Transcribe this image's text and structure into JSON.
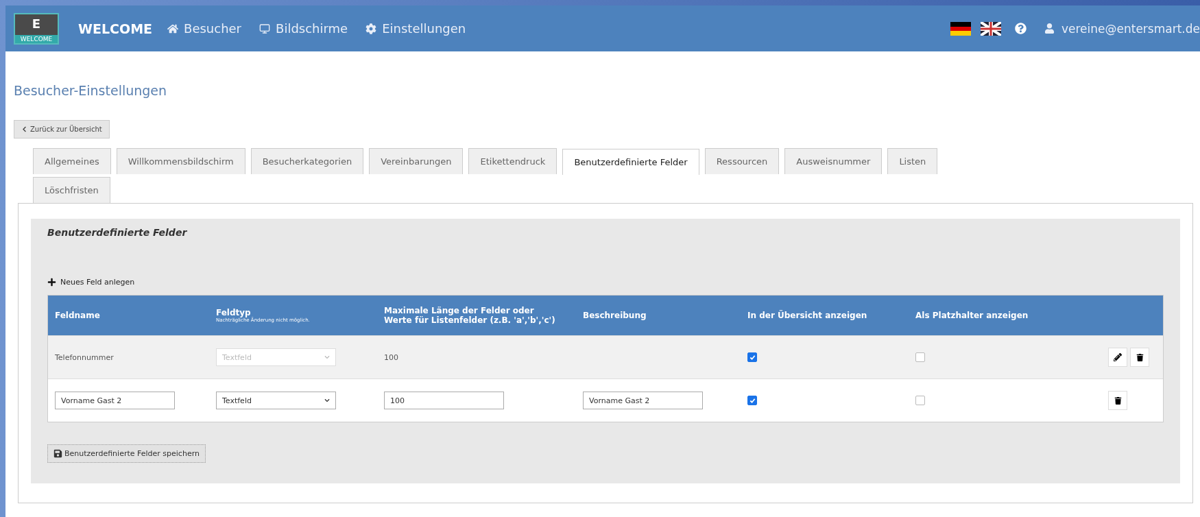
{
  "navbar": {
    "logo_letter": "E",
    "logo_caption": "WELCOME",
    "brand": "WELCOME",
    "items": [
      {
        "label": "Besucher",
        "kind": "home"
      },
      {
        "label": "Bildschirme",
        "kind": "monitor"
      },
      {
        "label": "Einstellungen",
        "kind": "settings"
      }
    ],
    "languages": [
      {
        "kind": "de"
      },
      {
        "kind": "uk"
      }
    ],
    "user": "vereine@entersmart.de"
  },
  "page_title": "Besucher-Einstellungen",
  "back_button": "Zurück zur Übersicht",
  "tabs": [
    {
      "label": "Allgemeines",
      "selected": false
    },
    {
      "label": "Willkommensbildschirm",
      "selected": false
    },
    {
      "label": "Besucherkategorien",
      "selected": false
    },
    {
      "label": "Vereinbarungen",
      "selected": false
    },
    {
      "label": "Etikettendruck",
      "selected": false
    },
    {
      "label": "Benutzerdefinierte Felder",
      "selected": true
    },
    {
      "label": "Ressourcen",
      "selected": false
    },
    {
      "label": "Ausweisnummer",
      "selected": false
    },
    {
      "label": "Listen",
      "selected": false
    },
    {
      "label": "Löschfristen",
      "selected": false
    }
  ],
  "section": {
    "legend": "Benutzerdefinierte Felder",
    "new_field": "Neues Feld anlegen",
    "columns": [
      {
        "label": "Feldname"
      },
      {
        "label": "Feldtyp",
        "note": "Nachträgliche Änderung nicht möglich."
      },
      {
        "label": "Maximale Länge der Felder oder Werte für Listenfelder (z.B. 'a','b','c')"
      },
      {
        "label": "Beschreibung"
      },
      {
        "label": "In der Übersicht anzeigen"
      },
      {
        "label": "Als Platzhalter anzeigen"
      }
    ],
    "rows": [
      {
        "kind": "saved",
        "name": "Telefonnummer",
        "type": "Textfeld",
        "max_length": "100",
        "show_in_overview": true,
        "as_placeholder": false,
        "editable": true
      },
      {
        "kind": "editing",
        "name": "Vorname Gast 2",
        "type": "Textfeld",
        "max_length": "100",
        "description": "Vorname Gast 2",
        "show_in_overview": true,
        "as_placeholder": false,
        "editable": false
      }
    ],
    "save_button": "Benutzerdefinierte Felder speichern"
  }
}
